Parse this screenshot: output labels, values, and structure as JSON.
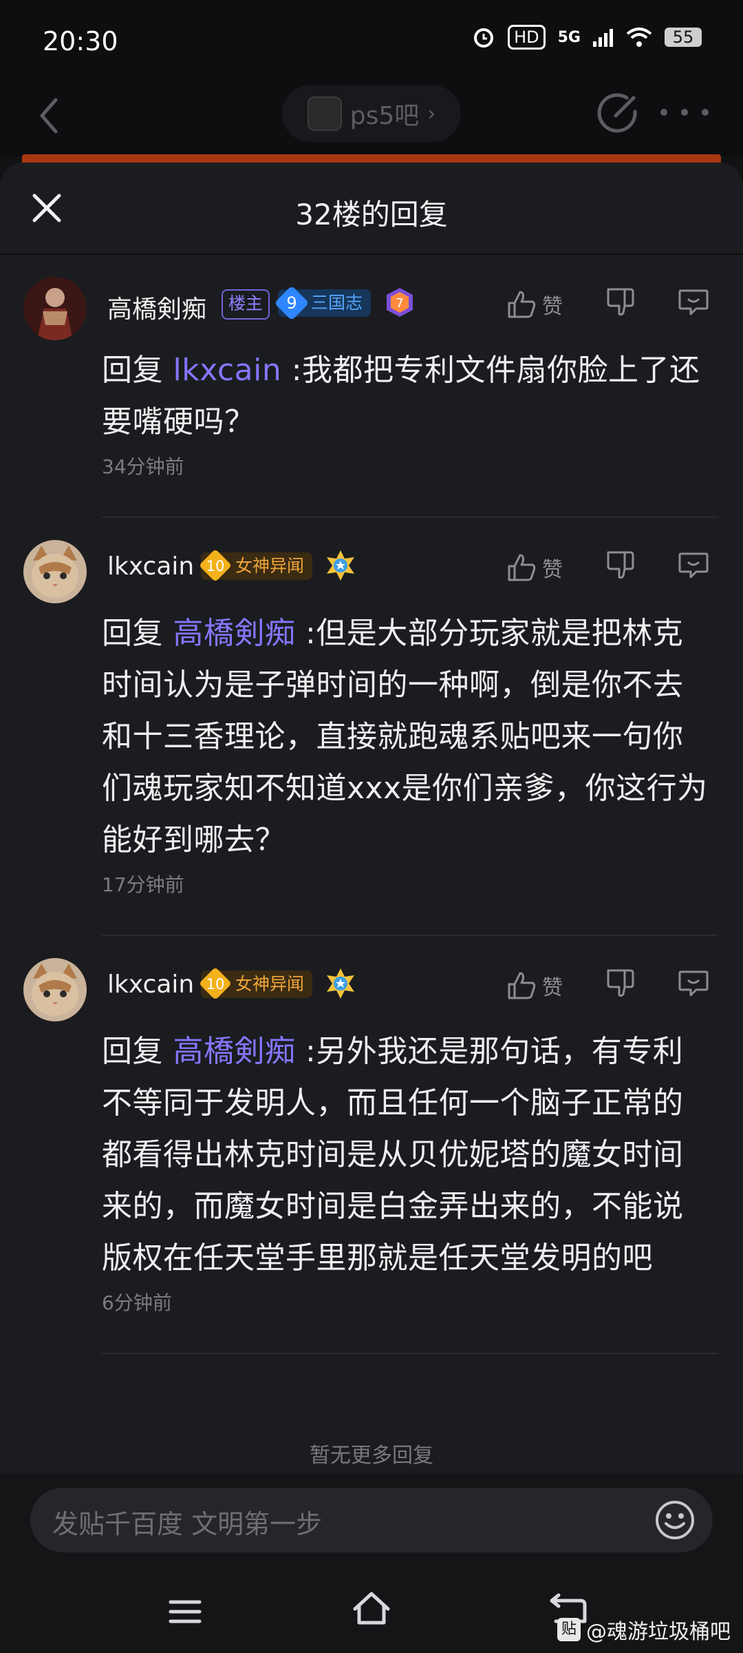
{
  "status_bar": {
    "time": "20:30",
    "hd": "HD",
    "network": "5G",
    "battery": "55"
  },
  "topbar": {
    "forum_name": "ps5吧",
    "chevron": "›"
  },
  "sheet": {
    "title": "32楼的回复"
  },
  "replies": [
    {
      "username": "高橋剣痴",
      "owner_badge": "楼主",
      "level": "9",
      "level_title": "三国志",
      "medal_number": "7",
      "like_label": "赞",
      "prefix": "回复 ",
      "mention": "lkxcain",
      "text": "  :我都把专利文件扇你脸上了还要嘴硬吗？",
      "time": "34分钟前"
    },
    {
      "username": "lkxcain",
      "level": "10",
      "level_title": "女神异闻",
      "like_label": "赞",
      "prefix": "回复 ",
      "mention": "高橋剣痴",
      "text": "  :但是大部分玩家就是把林克时间认为是子弹时间的一种啊，倒是你不去和十三香理论，直接就跑魂系贴吧来一句你们魂玩家知不知道xxx是你们亲爹，你这行为能好到哪去？",
      "time": "17分钟前"
    },
    {
      "username": "lkxcain",
      "level": "10",
      "level_title": "女神异闻",
      "like_label": "赞",
      "prefix": "回复 ",
      "mention": "高橋剣痴",
      "text": "  :另外我还是那句话，有专利不等同于发明人，而且任何一个脑子正常的都看得出林克时间是从贝优妮塔的魔女时间来的，而魔女时间是白金弄出来的，不能说版权在任天堂手里那就是任天堂发明的吧",
      "time": "6分钟前"
    }
  ],
  "no_more": "暂无更多回复",
  "input": {
    "placeholder": "发贴千百度 文明第一步"
  },
  "watermark": {
    "logo": "贴",
    "text": "@魂游垃圾桶吧"
  },
  "colors": {
    "mention": "#8476ff",
    "background": "#1b1c1f",
    "accent_orange": "#a93714"
  }
}
